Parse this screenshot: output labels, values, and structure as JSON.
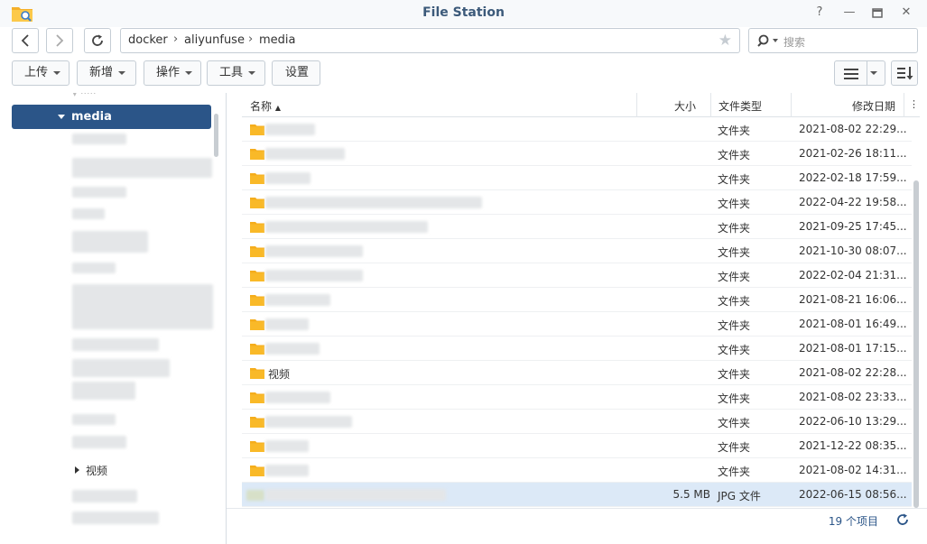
{
  "window": {
    "title": "File Station"
  },
  "path": {
    "segments": [
      "docker",
      "aliyunfuse",
      "media"
    ]
  },
  "search": {
    "placeholder": "搜索"
  },
  "toolbar": {
    "upload": "上传",
    "create": "新增",
    "action": "操作",
    "tools": "工具",
    "settings": "设置"
  },
  "tree": {
    "selected": "media",
    "expandable_item": "视频"
  },
  "grid": {
    "headers": {
      "name": "名称",
      "size": "大小",
      "type": "文件类型",
      "modified": "修改日期"
    },
    "rows": [
      {
        "name": "",
        "size": "",
        "type": "文件夹",
        "modified": "2021-08-02 22:29..."
      },
      {
        "name": "",
        "size": "",
        "type": "文件夹",
        "modified": "2021-02-26 18:11..."
      },
      {
        "name": "",
        "size": "",
        "type": "文件夹",
        "modified": "2022-02-18 17:59..."
      },
      {
        "name": "",
        "size": "",
        "type": "文件夹",
        "modified": "2022-04-22 19:58..."
      },
      {
        "name": "",
        "size": "",
        "type": "文件夹",
        "modified": "2021-09-25 17:45..."
      },
      {
        "name": "",
        "size": "",
        "type": "文件夹",
        "modified": "2021-10-30 08:07..."
      },
      {
        "name": "",
        "size": "",
        "type": "文件夹",
        "modified": "2022-02-04 21:31..."
      },
      {
        "name": "",
        "size": "",
        "type": "文件夹",
        "modified": "2021-08-21 16:06..."
      },
      {
        "name": "",
        "size": "",
        "type": "文件夹",
        "modified": "2021-08-01 16:49..."
      },
      {
        "name": "",
        "size": "",
        "type": "文件夹",
        "modified": "2021-08-01 17:15..."
      },
      {
        "name": "视频",
        "size": "",
        "type": "文件夹",
        "modified": "2021-08-02 22:28..."
      },
      {
        "name": "",
        "size": "",
        "type": "文件夹",
        "modified": "2021-08-02 23:33..."
      },
      {
        "name": "",
        "size": "",
        "type": "文件夹",
        "modified": "2022-06-10 13:29..."
      },
      {
        "name": "",
        "size": "",
        "type": "文件夹",
        "modified": "2021-12-22 08:35..."
      },
      {
        "name": "",
        "size": "",
        "type": "文件夹",
        "modified": "2021-08-02 14:31..."
      },
      {
        "name": "",
        "size": "5.5 MB",
        "type": "JPG 文件",
        "modified": "2022-06-15 08:56..."
      }
    ]
  },
  "status": {
    "item_count": "19 个项目"
  },
  "colors": {
    "accent": "#2b5588",
    "title": "#3c5a7a",
    "folder": "#f9b928",
    "selection": "#dce9f7"
  }
}
